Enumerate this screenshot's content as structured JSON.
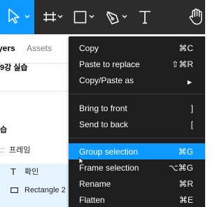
{
  "toolbar": {
    "tools": [
      {
        "icon": "move-cursor-icon",
        "active": true
      },
      {
        "icon": "frame-hash-icon",
        "active": false
      },
      {
        "icon": "rectangle-icon",
        "active": false
      },
      {
        "icon": "pen-icon",
        "active": false
      },
      {
        "icon": "text-icon",
        "active": false
      },
      {
        "icon": "hand-icon",
        "active": false
      }
    ],
    "text_tool_glyph": "T",
    "active_color": "#0d99ff",
    "background_color": "#2c2c2c"
  },
  "panel": {
    "tabs": [
      {
        "label": "yers"
      },
      {
        "label": "Assets"
      }
    ],
    "page_name": "9강 실습",
    "layers": [
      {
        "label": "습"
      },
      {
        "label": "프레임",
        "prefix": "::"
      },
      {
        "label": "확인",
        "icon": "text-layer-icon",
        "icon_glyph": "T",
        "selected": true
      },
      {
        "label": "Rectangle 2",
        "icon": "rectangle-layer-icon",
        "selected": true
      }
    ]
  },
  "context_menu": {
    "background_color": "#1e1e1e",
    "hover_color": "#0d99ff",
    "groups": [
      [
        {
          "label": "Copy",
          "shortcut": "⌘C"
        },
        {
          "label": "Paste to replace",
          "shortcut": "⇧⌘R"
        },
        {
          "label": "Copy/Paste as",
          "shortcut": "▶"
        }
      ],
      [
        {
          "label": "Bring to front",
          "shortcut": "]"
        },
        {
          "label": "Send to back",
          "shortcut": "["
        }
      ],
      [
        {
          "label": "Group selection",
          "shortcut": "⌘G",
          "hover": true
        },
        {
          "label": "Frame selection",
          "shortcut": "⌥⌘G"
        },
        {
          "label": "Rename",
          "shortcut": "⌘R"
        },
        {
          "label": "Flatten",
          "shortcut": "⌘E"
        }
      ]
    ]
  }
}
